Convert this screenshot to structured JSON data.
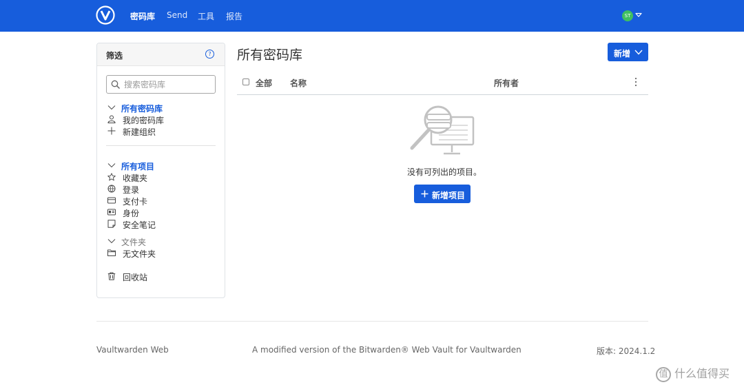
{
  "colors": {
    "brand": "#175ddc",
    "avatar": "#3fc060"
  },
  "nav": {
    "items": [
      {
        "label": "密码库",
        "active": true
      },
      {
        "label": "Send"
      },
      {
        "label": "工具"
      },
      {
        "label": "报告"
      }
    ],
    "avatar_initials": "ST"
  },
  "sidebar": {
    "title": "筛选",
    "help_glyph": "?",
    "search_placeholder": "搜索密码库",
    "vaults_group": "所有密码库",
    "vault_items": [
      "我的密码库",
      "新建组织"
    ],
    "items_group": "所有项目",
    "type_items": [
      "收藏夹",
      "登录",
      "支付卡",
      "身份",
      "安全笔记"
    ],
    "folders_group": "文件夹",
    "folder_items": [
      "无文件夹"
    ],
    "trash": "回收站"
  },
  "main": {
    "title": "所有密码库",
    "new_button": "新增",
    "columns": {
      "all": "全部",
      "name": "名称",
      "owner": "所有者"
    },
    "empty_message": "没有可列出的项目。",
    "add_item_button": "新增项目"
  },
  "footer": {
    "left": "Vaultwarden Web",
    "center": "A modified version of the Bitwarden® Web Vault for Vaultwarden",
    "version": "版本: 2024.1.2"
  },
  "watermark": {
    "icon_glyph": "值",
    "text": "什么值得买"
  }
}
